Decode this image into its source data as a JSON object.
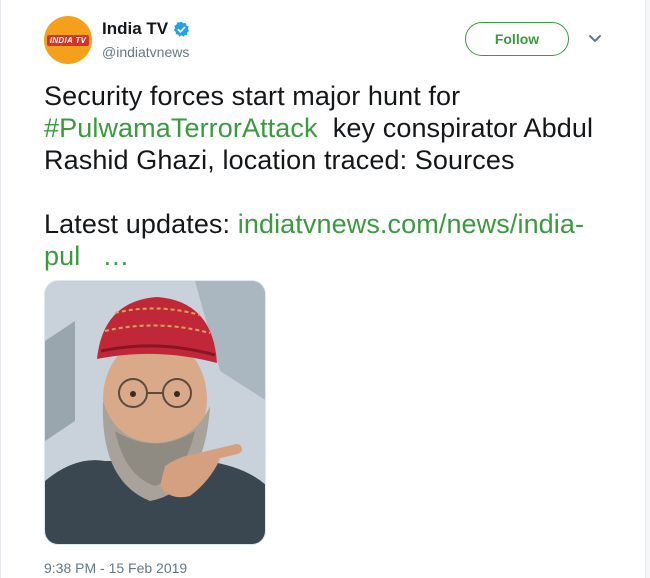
{
  "account": {
    "display_name": "India TV",
    "handle": "@indiatvnews",
    "avatar_text": "INDIA TV"
  },
  "follow_button": {
    "label": "Follow"
  },
  "tweet": {
    "line1": "Security forces start major hunt for",
    "hashtag": "#PulwamaTerrorAttack",
    "line2_rest": "  key conspirator Abdul",
    "line3": "Rashid Ghazi, location traced: Sources",
    "updates_label": "Latest updates: ",
    "link_part1": "indiatvnews.com/news/india-",
    "link_part2": "pul",
    "ellipsis": "…"
  },
  "timestamp": "9:38 PM - 15 Feb 2019",
  "colors": {
    "accent": "#3a9a3e",
    "verified": "#1da1f2",
    "avatar_bg": "#f5a01a",
    "muted_text": "#657786"
  },
  "icons": {
    "verified": "verified-badge-icon",
    "caret": "chevron-down-icon"
  }
}
